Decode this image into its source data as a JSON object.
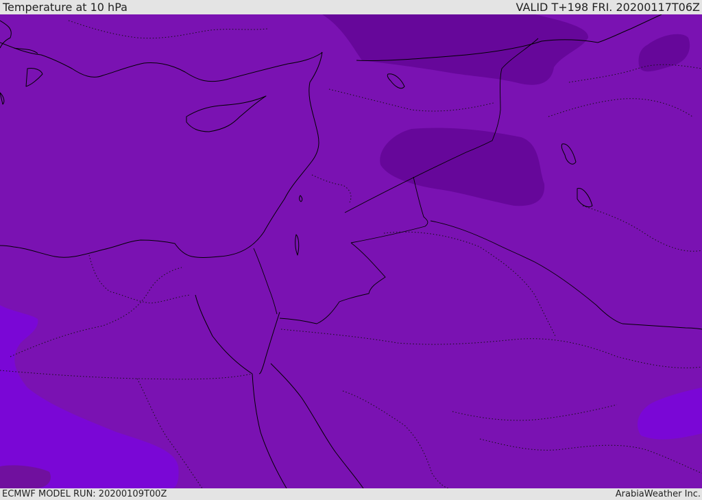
{
  "header": {
    "title": "Temperature at 10 hPa",
    "valid_time": "VALID T+198 FRI. 20200117T06Z"
  },
  "footer": {
    "model_run": "ECMWF MODEL RUN: 20200109T00Z",
    "credit": "ArabiaWeather Inc."
  },
  "colors": {
    "base_field": "#7a12b2",
    "cold_field": "#66079a",
    "warm_field": "#7a07d6",
    "lines": "#000000",
    "bar_background": "#e4e4e4"
  }
}
